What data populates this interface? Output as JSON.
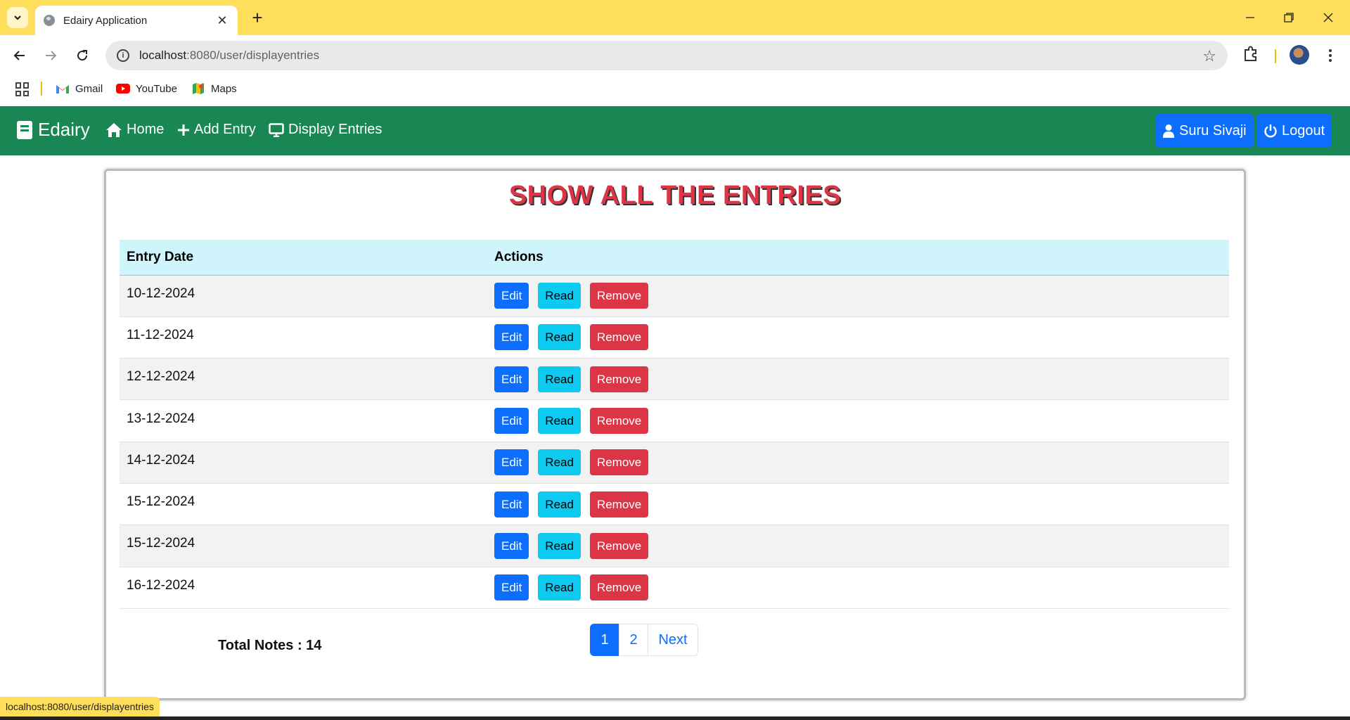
{
  "browser": {
    "tab_title": "Edairy Application",
    "url_host": "localhost",
    "url_path": ":8080/user/displayentries",
    "bookmarks": [
      {
        "label": "Gmail",
        "icon": "gmail-icon"
      },
      {
        "label": "YouTube",
        "icon": "youtube-icon"
      },
      {
        "label": "Maps",
        "icon": "maps-icon"
      }
    ],
    "status_url": "localhost:8080/user/displayentries"
  },
  "navbar": {
    "brand": "Edairy",
    "home": "Home",
    "add_entry": "Add Entry",
    "display_entries": "Display Entries",
    "user": "Suru Sivaji",
    "logout": "Logout",
    "color": "#198754"
  },
  "main": {
    "title": "SHOW ALL THE ENTRIES",
    "columns": [
      "Entry Date",
      "Actions"
    ],
    "actions": {
      "edit": "Edit",
      "read": "Read",
      "remove": "Remove"
    },
    "entries": [
      "10-12-2024",
      "11-12-2024",
      "12-12-2024",
      "13-12-2024",
      "14-12-2024",
      "15-12-2024",
      "15-12-2024",
      "16-12-2024"
    ],
    "total_label": "Total Notes : 14",
    "pagination": {
      "pages": [
        "1",
        "2"
      ],
      "current": "1",
      "next": "Next"
    }
  }
}
